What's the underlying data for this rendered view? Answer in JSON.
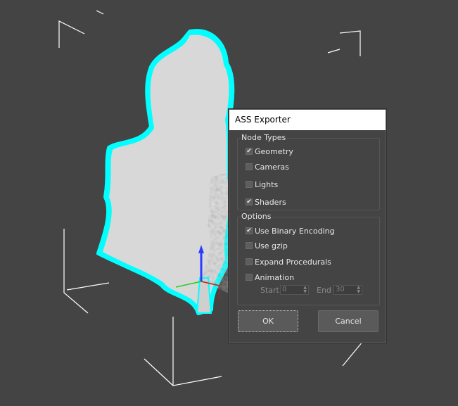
{
  "dialog": {
    "title": "ASS Exporter",
    "node_types": {
      "label": "Node Types",
      "items": [
        {
          "label": "Geometry",
          "checked": true
        },
        {
          "label": "Cameras",
          "checked": false
        },
        {
          "label": "Lights",
          "checked": false
        },
        {
          "label": "Shaders",
          "checked": true
        }
      ]
    },
    "options": {
      "label": "Options",
      "items": [
        {
          "label": "Use Binary Encoding",
          "checked": true
        },
        {
          "label": "Use gzip",
          "checked": false
        },
        {
          "label": "Expand Procedurals",
          "checked": false
        },
        {
          "label": "Animation",
          "checked": false
        }
      ],
      "start_label": "Start",
      "start_value": "0",
      "end_label": "End",
      "end_value": "30"
    },
    "ok_label": "OK",
    "cancel_label": "Cancel",
    "check_glyph": "✔"
  },
  "colors": {
    "viewport_bg": "#444444",
    "selection_outline": "#00ffff",
    "bounding_box": "#ffffff"
  },
  "icons": [
    "checkmark-icon",
    "spinner-up-icon",
    "spinner-down-icon",
    "axis-gizmo-icon"
  ]
}
